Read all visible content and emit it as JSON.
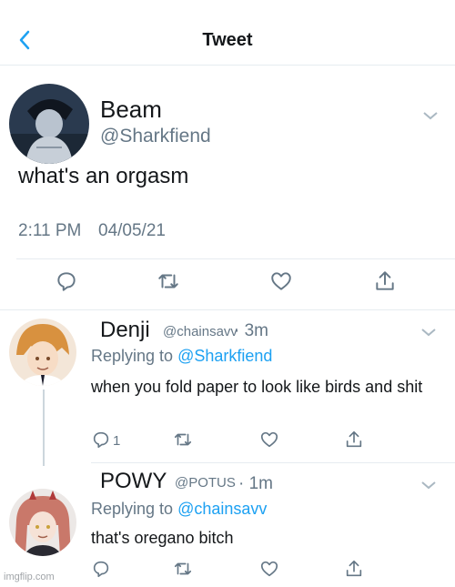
{
  "header": {
    "title": "Tweet",
    "back_icon": "chevron-left-icon"
  },
  "main_tweet": {
    "name": "Beam",
    "handle": "@Sharkfiend",
    "text": "what's an orgasm",
    "time": "2:11 PM",
    "date": "04/05/21",
    "actions": [
      "reply-icon",
      "retweet-icon",
      "like-icon",
      "share-icon"
    ]
  },
  "replies": [
    {
      "name": "Denji",
      "handle": "@chainsavv",
      "time": "· 3m",
      "replying_prefix": "Replying to ",
      "replying_to": "@Sharkfiend",
      "text": "when you fold paper to look like birds and shit",
      "reply_count": "1"
    },
    {
      "name": "POWY",
      "handle": "@POTUS",
      "time": "· 1m",
      "replying_prefix": "Replying to ",
      "replying_to": "@chainsavv",
      "text": "that's oregano bitch"
    }
  ],
  "watermark": "imgflip.com",
  "colors": {
    "accent": "#1da1f2",
    "secondary_text": "#657786",
    "divider": "#e6ecf0",
    "icon": "#657786"
  }
}
